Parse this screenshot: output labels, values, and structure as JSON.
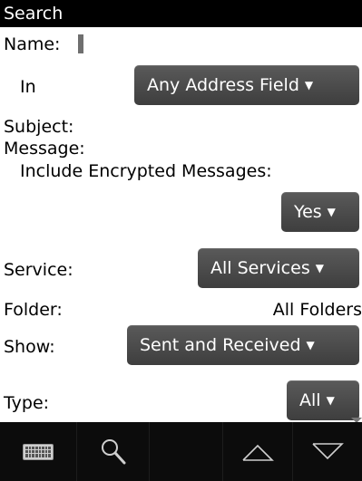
{
  "title": "Search",
  "fields": {
    "name_label": "Name:",
    "in_label": "In",
    "in_value": "Any Address Field",
    "subject_label": "Subject:",
    "message_label": "Message:",
    "include_encrypted_label": "Include Encrypted Messages:",
    "include_encrypted_value": "Yes",
    "service_label": "Service:",
    "service_value": "All Services",
    "folder_label": "Folder:",
    "folder_value": "All Folders",
    "show_label": "Show:",
    "show_value": "Sent and Received",
    "type_label": "Type:",
    "type_value": "All"
  },
  "dropdown_arrow": "▼",
  "toolbar": {
    "icons": [
      "keyboard-icon",
      "search-icon",
      "",
      "arrow-up-icon",
      "arrow-down-icon"
    ]
  },
  "colors": {
    "title_bar": "#000000",
    "dropdown_bg": "#4a4a4a",
    "toolbar_bg": "#0c0c0c"
  }
}
